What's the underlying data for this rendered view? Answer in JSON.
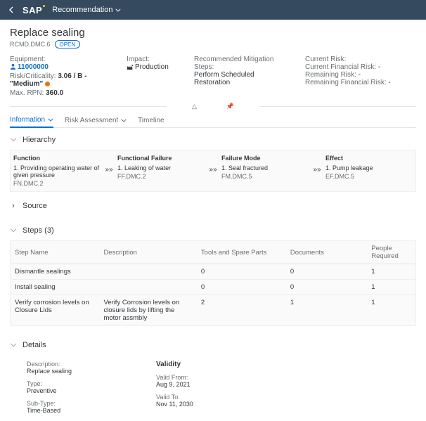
{
  "shell": {
    "appTitle": "Recommendation",
    "logo": "SAP"
  },
  "object": {
    "title": "Replace sealing",
    "id": "RCMD.DMC.6",
    "status": "OPEN"
  },
  "header": {
    "equipmentLabel": "Equipment:",
    "equipmentValue": "11000000",
    "riskLabel": "Risk/Criticality:",
    "riskValue": "3.06 / B - \"Medium\"",
    "maxRpnLabel": "Max. RPN:",
    "maxRpnValue": "360.0",
    "impactLabel": "Impact:",
    "impactValue": "Production",
    "mitigationLabel": "Recommended Mitigation Steps:",
    "mitigationValue": "Perform Scheduled Restoration",
    "currentRiskLabel": "Current Risk:",
    "currentFinRiskLabel": "Current Financial Risk:",
    "currentFinRiskValue": "-",
    "remainingRiskLabel": "Remaining Risk:",
    "remainingRiskValue": "-",
    "remainingFinRiskLabel": "Remaining Financial Risk:",
    "remainingFinRiskValue": "-"
  },
  "tabs": {
    "information": "Information",
    "riskAssessment": "Risk Assessment",
    "timeline": "Timeline"
  },
  "sections": {
    "hierarchy": "Hierarchy",
    "source": "Source",
    "steps": "Steps (3)",
    "details": "Details"
  },
  "hierarchy": {
    "function": {
      "label": "Function",
      "item": "Providing operating water of given pressure",
      "code": "FN.DMC.2",
      "num": "1."
    },
    "failure": {
      "label": "Functional Failure",
      "item": "Leaking of water",
      "code": "FF.DMC.2",
      "num": "1."
    },
    "mode": {
      "label": "Failure Mode",
      "item": "Seal fractured",
      "code": "FM.DMC.5",
      "num": "1."
    },
    "effect": {
      "label": "Effect",
      "item": "Pump leakage",
      "code": "EF.DMC.5",
      "num": "1."
    }
  },
  "stepsTable": {
    "cols": {
      "name": "Step Name",
      "desc": "Description",
      "tools": "Tools and Spare Parts",
      "docs": "Documents",
      "people": "People Required"
    },
    "rows": [
      {
        "name": "Dismantle sealings",
        "desc": "",
        "tools": "0",
        "docs": "0",
        "people": "1"
      },
      {
        "name": "Install sealing",
        "desc": "",
        "tools": "0",
        "docs": "0",
        "people": "1"
      },
      {
        "name": "Verify corrosion levels on Closure Lids",
        "desc": "Verify Corrosion levels on closure lids by lifting the motor assmbly",
        "tools": "2",
        "docs": "1",
        "people": "1"
      }
    ]
  },
  "details": {
    "descriptionLabel": "Description:",
    "descriptionValue": "Replace sealing",
    "typeLabel": "Type:",
    "typeValue": "Preventive",
    "subTypeLabel": "Sub-Type:",
    "subTypeValue": "Time-Based",
    "validityHeader": "Validity",
    "validFromLabel": "Valid From:",
    "validFromValue": "Aug 9, 2021",
    "validToLabel": "Valid To:",
    "validToValue": "Nov 11, 2030"
  }
}
